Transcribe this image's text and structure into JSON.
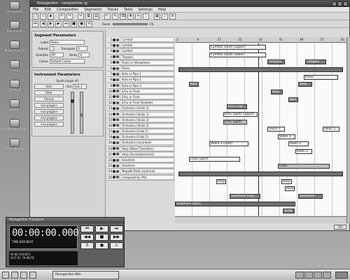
{
  "desktop_icons": [
    "Rosegarden",
    "Documents",
    "Music Projects",
    "Trash",
    "CD Player",
    "Home",
    "Rosegarden Studio",
    "Device Manager"
  ],
  "window": {
    "title": "Rosegarden - composition.rg",
    "menus": [
      "File",
      "Edit",
      "Composition",
      "Segments",
      "Tracks",
      "Tools",
      "Settings",
      "Help"
    ],
    "zoom_label": "Zoom",
    "zoom_value": "1%"
  },
  "segment_params": {
    "title": "Segment Parameters",
    "label_label": "Label",
    "label_value": "Piano",
    "repeat_label": "Repeat",
    "transpose_label": "Transpose",
    "transpose_value": "0",
    "quantize_label": "Quantize",
    "quantize_value": "Off",
    "delay_label": "Delay",
    "delay_value": "0",
    "colour_label": "Colour",
    "colour_value": "Default Colour"
  },
  "instrument_params": {
    "title": "Instrument Parameters",
    "synth": "Synth plugin #1",
    "instr_btn": "Instr",
    "out_label": "Out",
    "out_value": "Sub 2",
    "filter_btn": "Filter",
    "chorus_btn": "Chorus",
    "plugin_btns": [
      "<no plugin>",
      "<no plugin>",
      "<no plugin>",
      "<no plugin>"
    ]
  },
  "tracks": [
    {
      "n": "1",
      "name": "Cymbal"
    },
    {
      "n": "2",
      "name": "Cymbal"
    },
    {
      "n": "3",
      "name": "Cymbal"
    },
    {
      "n": "4",
      "name": "Timpani"
    },
    {
      "n": "5",
      "name": "Piano or Vibraphone"
    },
    {
      "n": "6",
      "name": "Piano"
    },
    {
      "n": "7",
      "name": "Koto or Pipa 1"
    },
    {
      "n": "8",
      "name": "Koto or Pipa 2"
    },
    {
      "n": "9",
      "name": "Koto or Pipa 3"
    },
    {
      "n": "10",
      "name": "Erhu or Flute"
    },
    {
      "n": "11",
      "name": "Erhu or Flute"
    },
    {
      "n": "12",
      "name": "Erhu or Flute Doubled"
    },
    {
      "n": "13",
      "name": "Orchestra (Violin 1)"
    },
    {
      "n": "14",
      "name": "Orchestra (Violin 1)"
    },
    {
      "n": "15",
      "name": "Orchestra (Violin 2)"
    },
    {
      "n": "16",
      "name": "Orchestra (Violin 2)"
    },
    {
      "n": "17",
      "name": "Orchestra (Cello 1)"
    },
    {
      "n": "18",
      "name": "Orchestra (Cello 2)"
    },
    {
      "n": "19",
      "name": "Orchestra (recorded)"
    },
    {
      "n": "20",
      "name": "Harp (Wood Transition)"
    },
    {
      "n": "21",
      "name": "Harp (Accompaniment)"
    },
    {
      "n": "22",
      "name": "Seashore"
    },
    {
      "n": "23",
      "name": "Seashore"
    },
    {
      "n": "24",
      "name": "Mapalbi Birds (optional)"
    },
    {
      "n": "25",
      "name": "composed by Phil"
    }
  ],
  "ruler": [
    "1",
    "9",
    "17",
    "25",
    "33",
    "41",
    "49",
    "57",
    "65"
  ],
  "segments": [
    {
      "label": "Cymbal (split)",
      "track": 0,
      "start": 0.02,
      "len": 0.2,
      "tone": "lt"
    },
    {
      "label": "Cymb",
      "track": 0,
      "start": 0.24,
      "len": 0.08,
      "tone": "lt"
    },
    {
      "label": "Cy",
      "track": 0,
      "start": 0.62,
      "len": 0.05,
      "tone": "lt"
    },
    {
      "label": "Cym",
      "track": 0,
      "start": 0.76,
      "len": 0.05,
      "tone": "lt"
    },
    {
      "label": "Cy",
      "track": 0,
      "start": 0.88,
      "len": 0.05,
      "tone": "lt"
    },
    {
      "label": "Cymbal (split) (upper)",
      "track": 1,
      "start": 0.2,
      "len": 0.33,
      "tone": "lt"
    },
    {
      "label": "Cymbal (split) (lower)",
      "track": 2,
      "start": 0.2,
      "len": 0.33,
      "tone": "lt"
    },
    {
      "label": "Timpani",
      "track": 3,
      "start": 0.54,
      "len": 0.1,
      "tone": "dk"
    },
    {
      "label": "Timpani",
      "track": 3,
      "start": 0.76,
      "len": 0.12,
      "tone": "dk"
    },
    {
      "label": "",
      "track": 4,
      "start": 0.02,
      "len": 0.96,
      "tone": "x"
    },
    {
      "label": "Piano",
      "track": 5,
      "start": 0.75,
      "len": 0.2,
      "tone": "lt"
    },
    {
      "label": "Koto",
      "track": 6,
      "start": 0.08,
      "len": 0.06,
      "tone": "dk"
    },
    {
      "label": "Koto",
      "track": 6,
      "start": 0.72,
      "len": 0.08,
      "tone": "dk"
    },
    {
      "label": "Koto",
      "track": 7,
      "start": 0.56,
      "len": 0.07,
      "tone": "dk"
    },
    {
      "label": "Koto",
      "track": 8,
      "start": 0.66,
      "len": 0.06,
      "tone": "dk"
    },
    {
      "label": "Erhu (cop...",
      "track": 9,
      "start": 0.3,
      "len": 0.12,
      "tone": "dk"
    },
    {
      "label": "Erhu (split) (upper)",
      "track": 10,
      "start": 0.28,
      "len": 0.2,
      "tone": "lt"
    },
    {
      "label": "Erhu (split)",
      "track": 11,
      "start": 0.28,
      "len": 0.14,
      "tone": "md"
    },
    {
      "label": "Violin 1",
      "track": 12,
      "start": 0.54,
      "len": 0.1,
      "tone": "lt"
    },
    {
      "label": "Violin 1",
      "track": 12,
      "start": 0.86,
      "len": 0.1,
      "tone": "lt"
    },
    {
      "label": "Violin 1",
      "track": 13,
      "start": 0.6,
      "len": 0.1,
      "tone": "lt"
    },
    {
      "label": "Violin 2 (split)",
      "track": 14,
      "start": 0.2,
      "len": 0.23,
      "tone": "lt"
    },
    {
      "label": "Violin 2",
      "track": 14,
      "start": 0.66,
      "len": 0.12,
      "tone": "lt"
    },
    {
      "label": "Violin 2",
      "track": 15,
      "start": 0.7,
      "len": 0.1,
      "tone": "lt"
    },
    {
      "label": "Cello (split)",
      "track": 16,
      "start": 0.08,
      "len": 0.3,
      "tone": "lt"
    },
    {
      "label": "Cello",
      "track": 17,
      "start": 0.6,
      "len": 0.3,
      "tone": "md"
    },
    {
      "label": "",
      "track": 18,
      "start": 0.02,
      "len": 0.96,
      "tone": "x"
    },
    {
      "label": "Harp",
      "track": 19,
      "start": 0.24,
      "len": 0.06,
      "tone": "lt"
    },
    {
      "label": "Harp",
      "track": 19,
      "start": 0.62,
      "len": 0.06,
      "tone": "lt"
    },
    {
      "label": "Harp",
      "track": 20,
      "start": 0.64,
      "len": 0.06,
      "tone": "lt"
    },
    {
      "label": "Seashore (cop...",
      "track": 21,
      "start": 0.32,
      "len": 0.18,
      "tone": "dk"
    },
    {
      "label": "Seashore",
      "track": 21,
      "start": 0.72,
      "len": 0.14,
      "tone": "dk"
    },
    {
      "label": "Seashore (split)",
      "track": 22,
      "start": 0.0,
      "len": 0.7,
      "tone": "x"
    },
    {
      "label": "birds",
      "track": 23,
      "start": 0.63,
      "len": 0.07,
      "tone": "dk"
    },
    {
      "label": "",
      "track": 24,
      "start": 0.02,
      "len": 0.96,
      "tone": "x"
    }
  ],
  "transport": {
    "title": "Rosegarden Transport",
    "time": "00:00:00.000",
    "sub": "TIME  BAR  BEAT",
    "info1": "IN  NO EVENTS",
    "info2": "OUT  PC 79  MUTE"
  },
  "taskbar": {
    "task_label": "Rosegarden Win"
  },
  "cpu": "CPU"
}
